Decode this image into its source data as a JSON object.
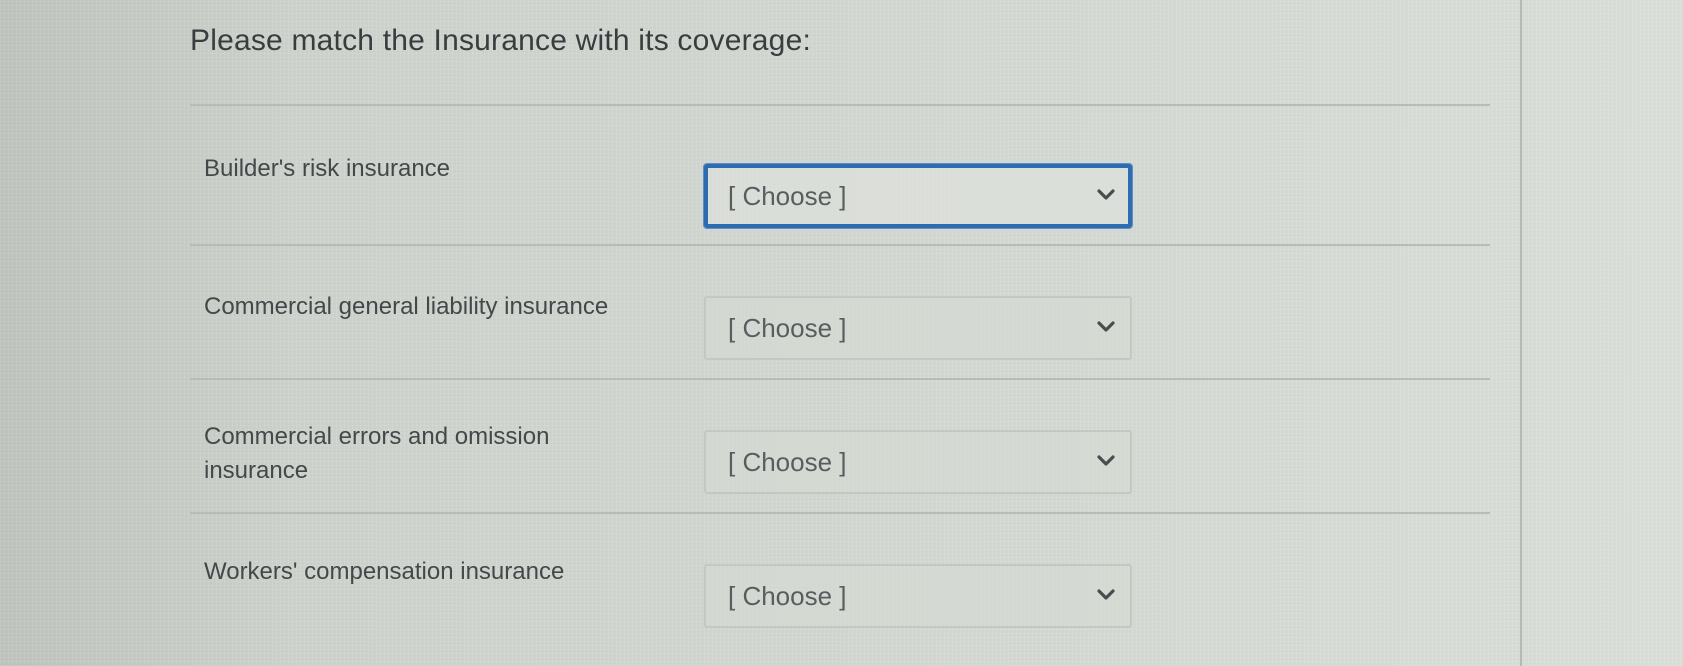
{
  "question": {
    "title": "Please match the Insurance with its coverage:",
    "rows": [
      {
        "label": "Builder's risk insurance",
        "select_value": "[ Choose ]",
        "focused": true
      },
      {
        "label": "Commercial general liability insurance",
        "select_value": "[ Choose ]",
        "focused": false
      },
      {
        "label_line1": "Commercial errors and omission",
        "label_line2": "insurance",
        "select_value": "[ Choose ]",
        "focused": false
      },
      {
        "label": "Workers' compensation insurance",
        "select_value": "[ Choose ]",
        "focused": false
      }
    ]
  },
  "icons": {
    "dropdown": "chevron-down-icon"
  },
  "colors": {
    "focus_border": "#2e6bb0",
    "text": "#45484a",
    "divider": "#b7bcb6"
  }
}
